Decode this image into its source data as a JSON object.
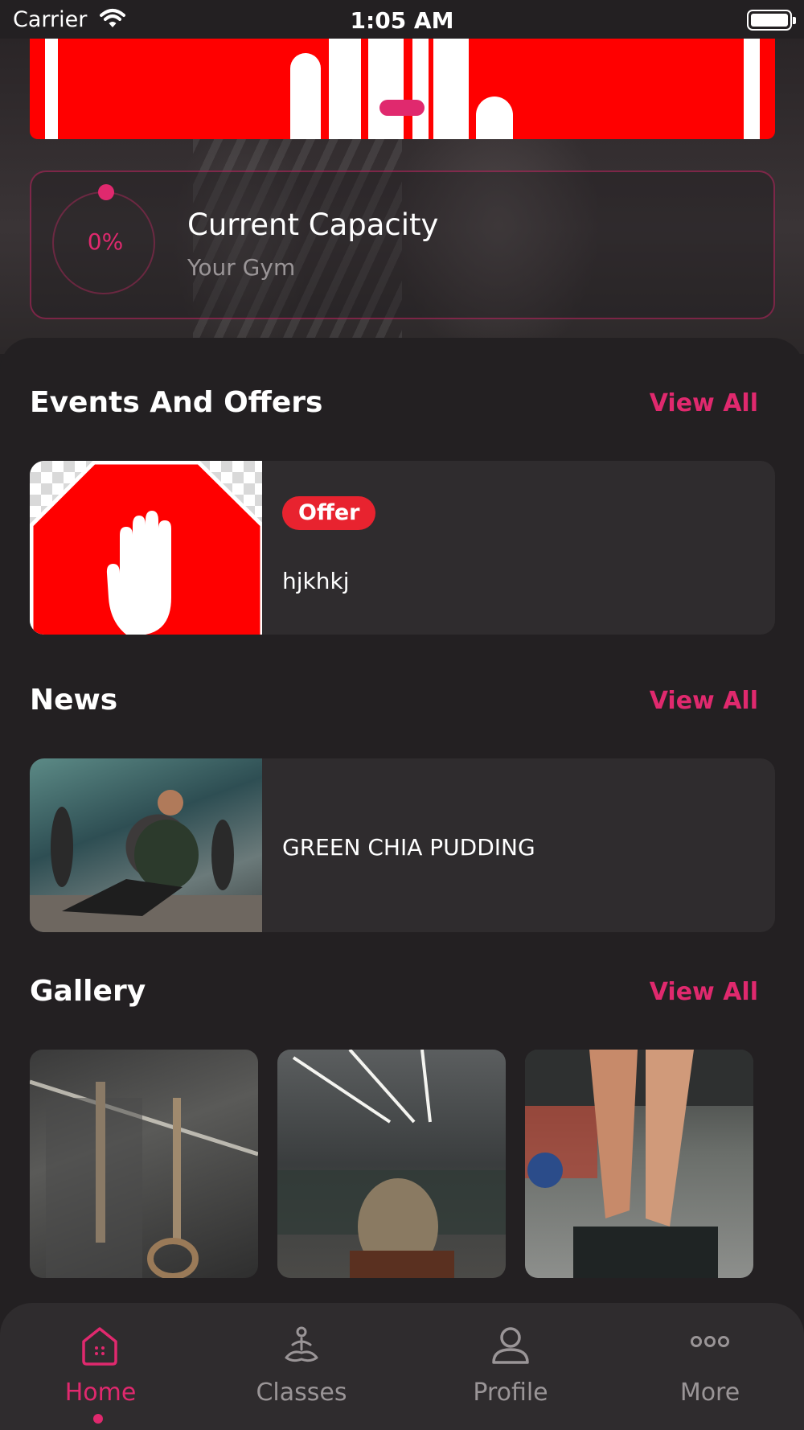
{
  "status_bar": {
    "carrier": "Carrier",
    "time": "1:05 AM"
  },
  "capacity": {
    "value": "0%",
    "title": "Current Capacity",
    "subtitle": "Your Gym"
  },
  "events": {
    "title": "Events And Offers",
    "view_all": "View All",
    "items": [
      {
        "badge": "Offer",
        "name": "hjkhkj"
      }
    ]
  },
  "news": {
    "title": "News",
    "view_all": "View All",
    "items": [
      {
        "title": "GREEN CHIA PUDDING"
      }
    ]
  },
  "gallery": {
    "title": "Gallery",
    "view_all": "View All"
  },
  "tabs": [
    {
      "label": "Home",
      "icon": "home-icon",
      "active": true
    },
    {
      "label": "Classes",
      "icon": "classes-icon",
      "active": false
    },
    {
      "label": "Profile",
      "icon": "profile-icon",
      "active": false
    },
    {
      "label": "More",
      "icon": "more-icon",
      "active": false
    }
  ],
  "colors": {
    "accent": "#e0296e",
    "background": "#232022",
    "card": "#2f2c2e",
    "offer_badge": "#e8232f"
  }
}
